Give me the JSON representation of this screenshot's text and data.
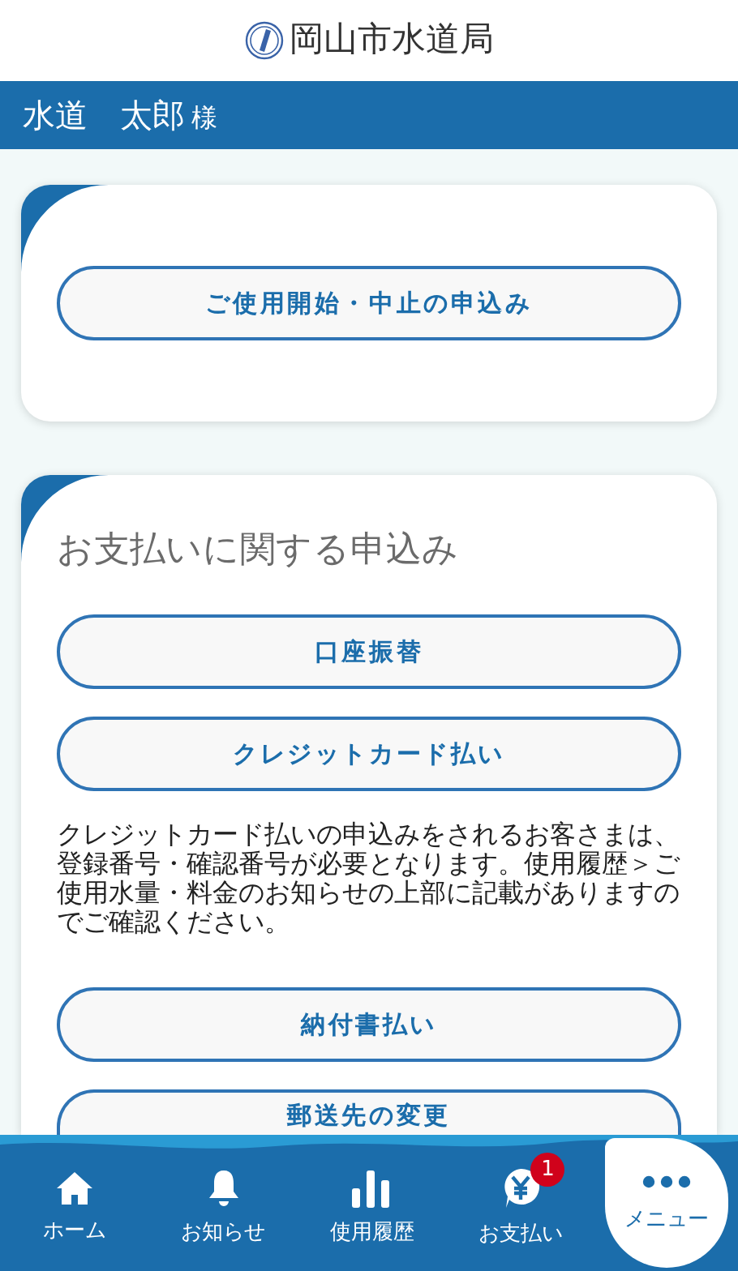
{
  "header": {
    "title": "岡山市水道局"
  },
  "user": {
    "name": "水道　太郎",
    "honorific": "様"
  },
  "cards": [
    {
      "buttons": [
        "ご使用開始・中止の申込み"
      ]
    },
    {
      "title": "お支払いに関する申込み",
      "buttons": [
        "口座振替",
        "クレジットカード払い"
      ],
      "note": "クレジットカード払いの申込みをされるお客さまは、登録番号・確認番号が必要となります。使用履歴＞ご使用水量・料金のお知らせの上部に記載がありますのでご確認ください。",
      "buttons_after": [
        "納付書払い",
        "郵送先の変更"
      ]
    }
  ],
  "nav": [
    {
      "kind": "home",
      "label": "ホーム"
    },
    {
      "kind": "bell",
      "label": "お知らせ"
    },
    {
      "kind": "chart",
      "label": "使用履歴"
    },
    {
      "kind": "yen",
      "label": "お支払い",
      "badge": "1"
    },
    {
      "kind": "menu",
      "label": "メニュー"
    }
  ]
}
